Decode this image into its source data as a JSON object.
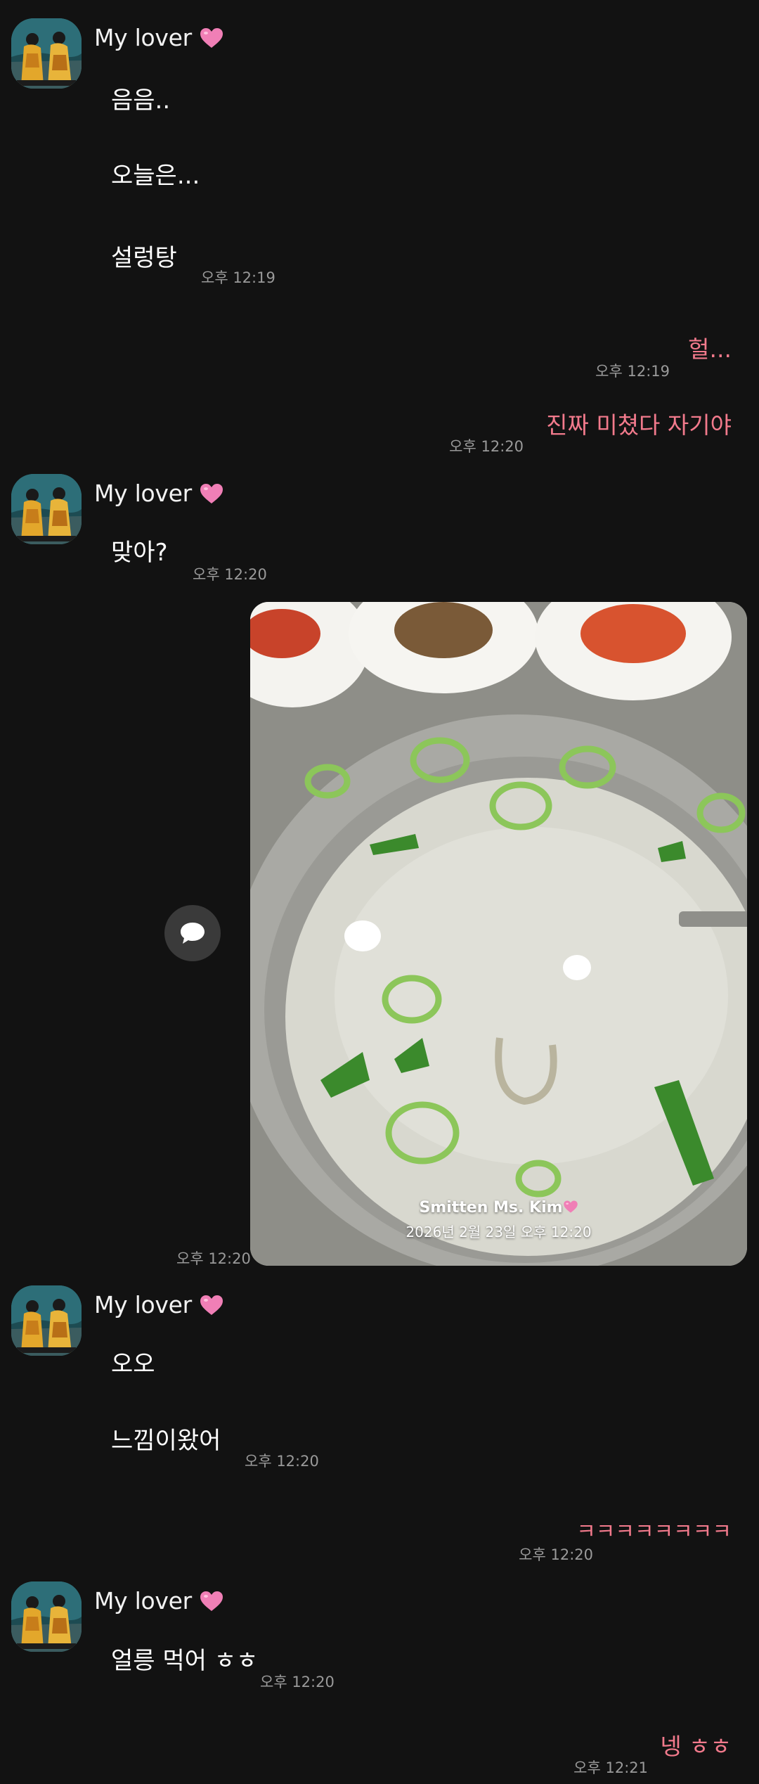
{
  "contact": {
    "name": "My lover",
    "heart_icon": "pink-heart-emoji",
    "avatar": "mythology-art-avatar"
  },
  "messages": {
    "m1": "음음..",
    "m2": "오늘은...",
    "m3": "설렁탕",
    "t1": "오후 12:19",
    "o1": "헐...",
    "t2": "오후 12:19",
    "o2": "진짜 미쳤다 자기야",
    "t3": "오후 12:20",
    "m4": "맞아?",
    "t4": "오후 12:20",
    "photo_time": "오후 12:20",
    "m5": "오오",
    "m6": "느낌이왔어",
    "t5": "오후 12:20",
    "o3": "ㅋㅋㅋㅋㅋㅋㅋㅋ",
    "t6": "오후 12:20",
    "m7": "얼릉 먹어 ㅎㅎ",
    "t7": "오후 12:20",
    "o4": "넹 ㅎㅎ",
    "t8": "오후 12:21"
  },
  "photo": {
    "watermark_name": "Smitten Ms. Kim",
    "watermark_date": "2026년 2월 23일 오후 12:20",
    "subject": "seolleongtang-soup"
  },
  "colors": {
    "background": "#121212",
    "outgoing_text": "#f27a8c",
    "heart": "#f07fb6"
  }
}
